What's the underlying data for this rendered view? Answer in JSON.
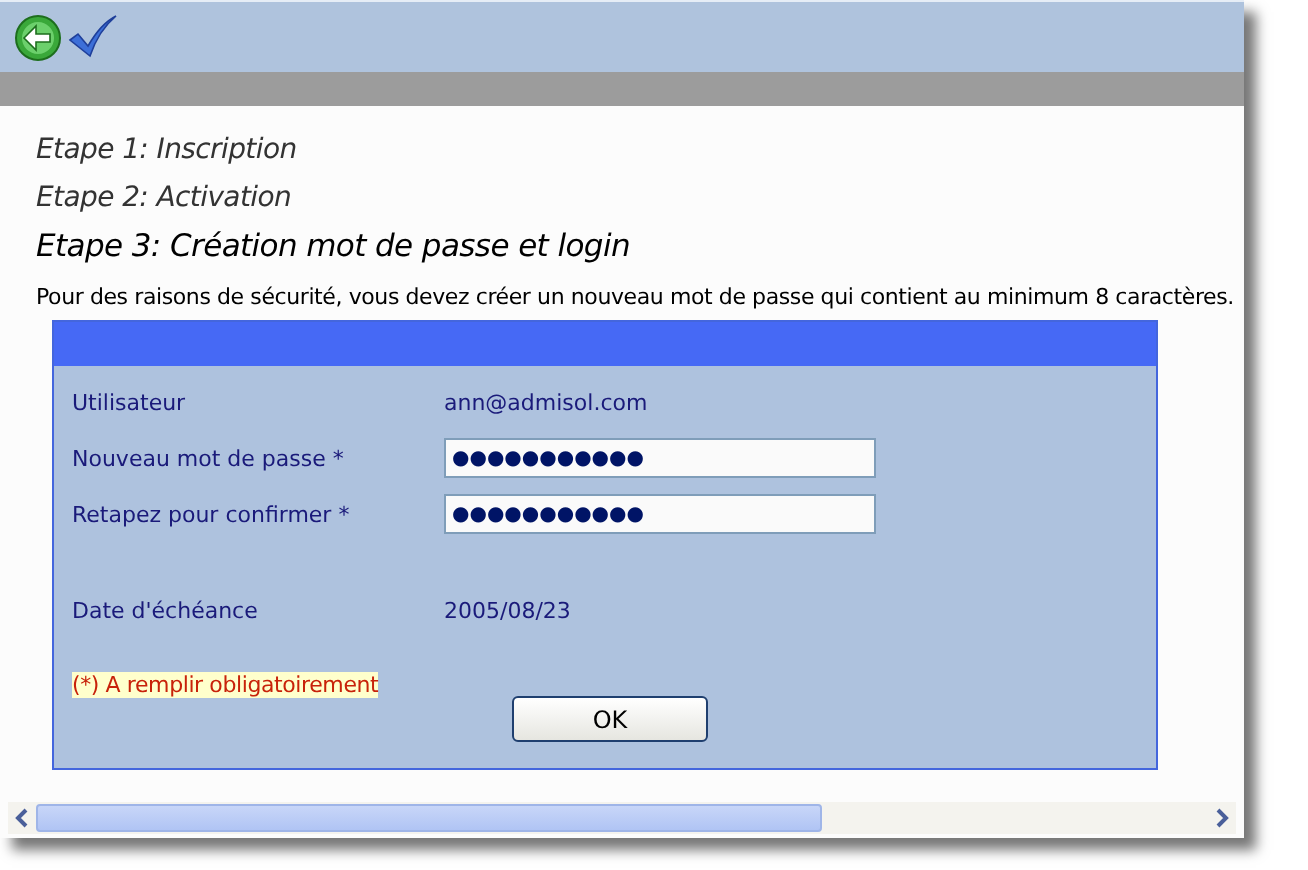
{
  "toolbar": {
    "buttons": [
      {
        "kind": "back"
      },
      {
        "kind": "confirm"
      }
    ]
  },
  "steps": [
    {
      "label": "Etape 1: Inscription",
      "selected": false
    },
    {
      "label": "Etape 2: Activation",
      "selected": false
    },
    {
      "label": "Etape 3: Création mot de passe et login",
      "selected": true
    }
  ],
  "intro": "Pour des raisons de sécurité, vous devez créer un nouveau mot de passe qui contient au minimum 8 caractères.",
  "form": {
    "rows": [
      {
        "kind": "text",
        "label": "Utilisateur",
        "value": "ann@admisol.com"
      },
      {
        "kind": "field",
        "label": "Nouveau mot de passe *",
        "value": "●●●●●●●●●●●"
      },
      {
        "kind": "field",
        "label": "Retapez pour confirmer *",
        "value": "●●●●●●●●●●●"
      },
      {
        "kind": "text",
        "label": "Date d'échéance",
        "value": "2005/08/23"
      }
    ],
    "note": "(*) A remplir obligatoirement",
    "button": "OK"
  }
}
